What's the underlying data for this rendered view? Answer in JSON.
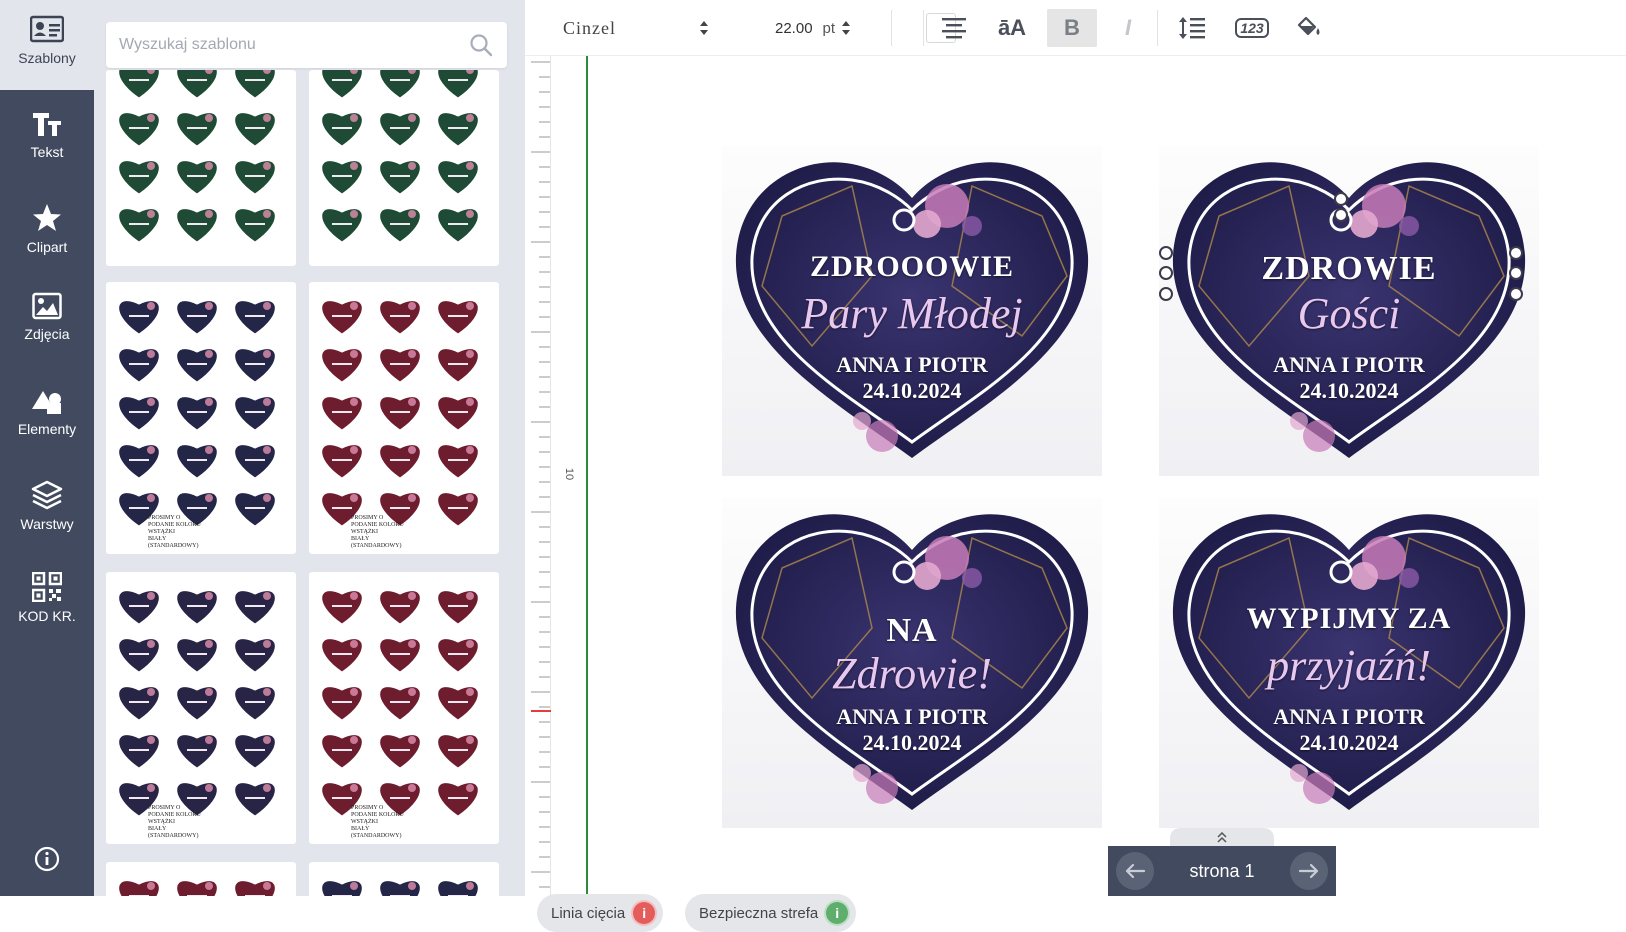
{
  "nav": {
    "items": [
      {
        "label": "Szablony",
        "icon": "id-card-icon"
      },
      {
        "label": "Tekst",
        "icon": "text-icon"
      },
      {
        "label": "Clipart",
        "icon": "star-icon"
      },
      {
        "label": "Zdjęcia",
        "icon": "image-icon"
      },
      {
        "label": "Elementy",
        "icon": "shapes-icon"
      },
      {
        "label": "Warstwy",
        "icon": "layers-icon"
      },
      {
        "label": "KOD KR.",
        "icon": "qr-code-icon"
      }
    ],
    "info_icon": "info-icon"
  },
  "templates": {
    "search_placeholder": "Wyszukaj szablonu",
    "thumb_footer_left": "PROSIMY O PODANIE KOLORU WSTĄŻKI",
    "thumb_footer_right": "BIAŁY (STANDARDOWY)",
    "thumbs": [
      {
        "variant": "green",
        "color": "#1f4a35"
      },
      {
        "variant": "green",
        "color": "#1f4a35"
      },
      {
        "variant": "navy-floral",
        "color": "#232647"
      },
      {
        "variant": "burgundy",
        "color": "#6e1d2e"
      },
      {
        "variant": "navy-purple",
        "color": "#272445"
      },
      {
        "variant": "burgundy",
        "color": "#6e1d2e"
      },
      {
        "variant": "burgundy",
        "color": "#6e1d2e"
      },
      {
        "variant": "navy",
        "color": "#232647"
      }
    ]
  },
  "toolbar": {
    "font_name": "Cinzel",
    "font_size": "22.00",
    "font_unit": "pt",
    "swatch_color": "#ffffff",
    "buttons": [
      {
        "name": "align-center-icon",
        "label": ""
      },
      {
        "name": "text-case-icon",
        "label": "āA"
      },
      {
        "name": "bold-icon",
        "label": "B",
        "active": true
      },
      {
        "name": "italic-icon",
        "label": "I"
      },
      {
        "name": "line-height-icon",
        "label": ""
      },
      {
        "name": "number-format-icon",
        "label": "123"
      },
      {
        "name": "fill-color-icon",
        "label": ""
      }
    ]
  },
  "ruler": {
    "label": "10"
  },
  "cards": [
    {
      "title": "ZDROOOWIE",
      "script": "Pary Młodej",
      "names": "ANNA I PIOTR",
      "date": "24.10.2024",
      "selected": false
    },
    {
      "title": "ZDROWIE",
      "script": "Gości",
      "names": "ANNA I PIOTR",
      "date": "24.10.2024",
      "selected": true
    },
    {
      "title": "NA",
      "script": "Zdrowie!",
      "names": "ANNA I PIOTR",
      "date": "24.10.2024",
      "selected": false
    },
    {
      "title": "WYPIJMY ZA",
      "script": "przyjaźń!",
      "names": "ANNA I PIOTR",
      "date": "24.10.2024",
      "selected": false
    }
  ],
  "bottom": {
    "cut_line": "Linia cięcia",
    "safe_zone": "Bezpieczna strefa",
    "page_label": "strona 1",
    "cut_color": "#e35d5d",
    "safe_color": "#5fae6e"
  }
}
